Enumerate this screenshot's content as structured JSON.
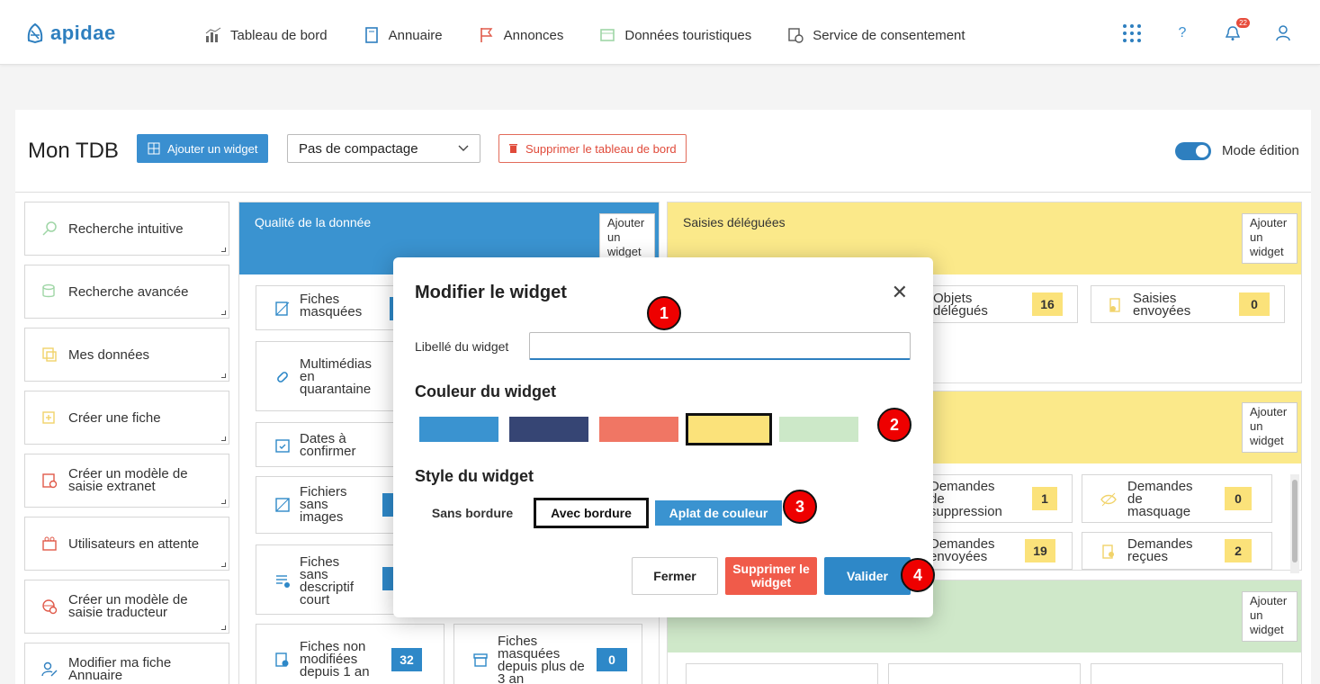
{
  "app": {
    "logo": "apidae"
  },
  "nav": [
    {
      "label": "Tableau de bord",
      "icon": "chart-icon"
    },
    {
      "label": "Annuaire",
      "icon": "book-icon"
    },
    {
      "label": "Annonces",
      "icon": "flag-icon"
    },
    {
      "label": "Données touristiques",
      "icon": "database-icon"
    },
    {
      "label": "Service de consentement",
      "icon": "consent-icon"
    }
  ],
  "top_right": {
    "notif_count": "22"
  },
  "dashboard": {
    "title": "Mon TDB",
    "add_widget": "Ajouter un widget",
    "compact_select": "Pas de compactage",
    "delete_dashboard": "Supprimer le tableau de bord",
    "mode_label": "Mode édition"
  },
  "sidebar": [
    {
      "label": "Recherche intuitive",
      "icon": "search-icon"
    },
    {
      "label": "Recherche avancée",
      "icon": "database-search-icon"
    },
    {
      "label": "Mes données",
      "icon": "data-icon"
    },
    {
      "label": "Créer une fiche",
      "icon": "create-file-icon"
    },
    {
      "label": "Créer un modèle de saisie extranet",
      "icon": "template-icon"
    },
    {
      "label": "Utilisateurs en attente",
      "icon": "users-waiting-icon"
    },
    {
      "label": "Créer un modèle de saisie traducteur",
      "icon": "translate-icon"
    },
    {
      "label": "Modifier ma fiche Annuaire",
      "icon": "edit-user-icon"
    }
  ],
  "widgets": {
    "add_label": "Ajouter un widget",
    "quality": {
      "title": "Qualité de la donnée",
      "items": [
        {
          "label": "Fiches masquées"
        },
        {
          "label": "Multimédias en quarantaine"
        },
        {
          "label": "Dates à confirmer"
        },
        {
          "label": "Fichiers sans images"
        },
        {
          "label": "Fiches sans descriptif court"
        },
        {
          "label": "Fiches non modifiées depuis 1 an",
          "count": "32"
        },
        {
          "label": "Fiches masquées depuis plus de 3 an",
          "count": "0"
        }
      ]
    },
    "delegated": {
      "title": "Saisies déléguées",
      "items": [
        {
          "label": "Objets délégués",
          "count": "16"
        },
        {
          "label": "Saisies envoyées",
          "count": "0"
        }
      ]
    },
    "requests": {
      "items": [
        {
          "label": "Demandes de suppression",
          "count": "1"
        },
        {
          "label": "Demandes de masquage",
          "count": "0"
        },
        {
          "label": "Demandes envoyées",
          "count": "19"
        },
        {
          "label": "Demandes reçues",
          "count": "2"
        }
      ]
    }
  },
  "modal": {
    "title": "Modifier le widget",
    "label_field": "Libellé du widget",
    "label_value": "",
    "color_section": "Couleur du widget",
    "colors": [
      "#3a93d0",
      "#364574",
      "#f07664",
      "#fbe27a",
      "#cce8c8"
    ],
    "style_section": "Style du widget",
    "styles": [
      "Sans bordure",
      "Avec bordure",
      "Aplat de couleur"
    ],
    "close_btn": "Fermer",
    "delete_btn": "Supprimer le widget",
    "validate_btn": "Valider",
    "markers": [
      "1",
      "2",
      "3",
      "4"
    ]
  }
}
